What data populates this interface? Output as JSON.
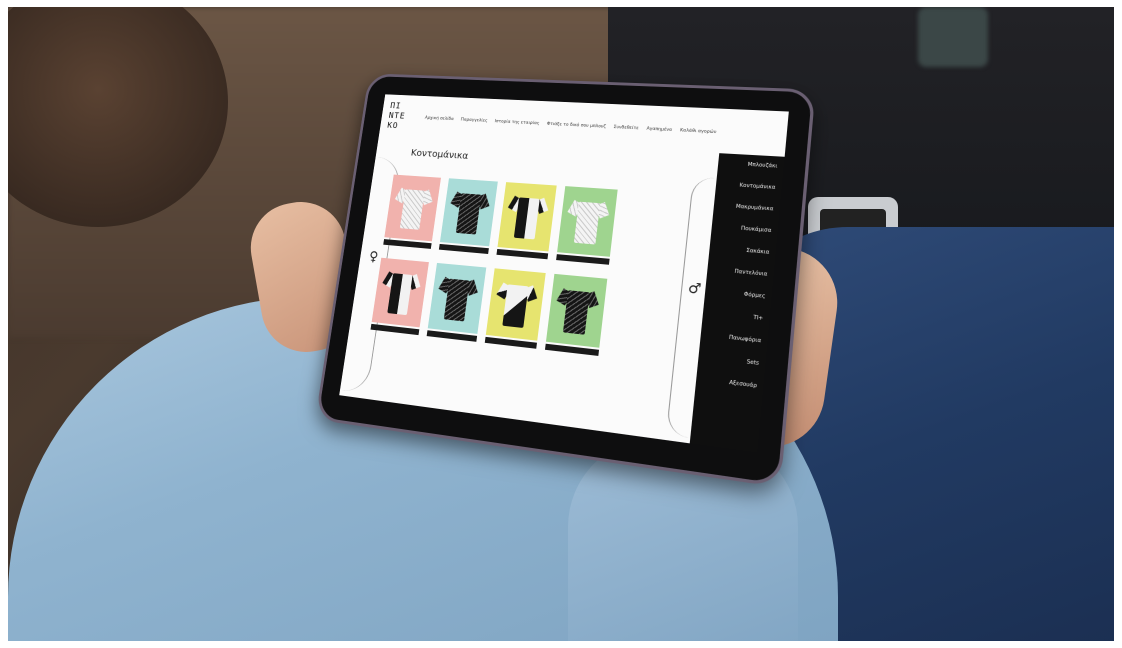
{
  "site": {
    "logo_lines": [
      "ΠΙ",
      "ΝΤΕ",
      "ΚΟ"
    ]
  },
  "nav": {
    "items": [
      "Αρχική σελίδα",
      "Παραγγελίες",
      "Ιστορία της εταιρίας",
      "Φτιάξε το δικό σου μπλουζ",
      "Συνδεθείτε",
      "Αγαπημένα",
      "Καλάθι αγορών"
    ]
  },
  "page": {
    "title": "Κοντομάνικα"
  },
  "sidebar": {
    "items": [
      "Μπλουζάκι",
      "Κοντομάνικα",
      "Μακρυμάνικα",
      "Πουκάμισα",
      "Σακάκια",
      "Παντελόνια",
      "Φόρμες",
      "ΤΙ+",
      "Πανωφόρια",
      "Sets",
      "Αξεσουάρ"
    ]
  },
  "symbols": {
    "female": "♀",
    "male": "♂"
  },
  "products": [
    {
      "bg": "pink",
      "pattern": "wb"
    },
    {
      "bg": "mint",
      "pattern": "bk"
    },
    {
      "bg": "yellow",
      "pattern": "half"
    },
    {
      "bg": "green",
      "pattern": "wb"
    },
    {
      "bg": "pink",
      "pattern": "half"
    },
    {
      "bg": "mint",
      "pattern": "bk"
    },
    {
      "bg": "yellow",
      "pattern": "diag"
    },
    {
      "bg": "green",
      "pattern": "bk"
    }
  ],
  "colors": {
    "pink": "#f1b2ad",
    "mint": "#a9dcd8",
    "yellow": "#e6e46f",
    "green": "#9fd48f",
    "tablet_bezel": "#0e0e0f",
    "shirt": "#8fb3cf",
    "jeans": "#213a62"
  }
}
